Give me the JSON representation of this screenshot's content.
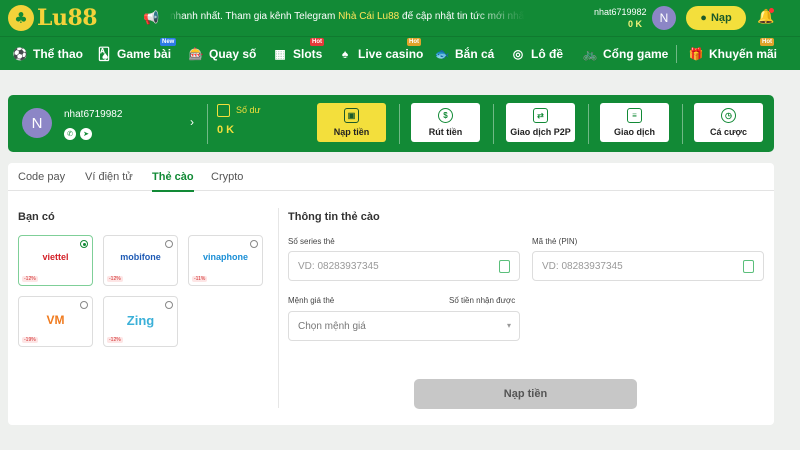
{
  "brand": {
    "logo_text": "Lu88",
    "logo_mark": "♣"
  },
  "topbar": {
    "announcement_pre": "nhanh nhất. Tham gia kênh Telegram ",
    "announcement_highlight": "Nhà Cái Lu88",
    "announcement_post": " để cập nhật tin tức mới nhất về mọi hoạt độ",
    "username": "nhat6719982",
    "balance": "0 K",
    "avatar_initial": "N",
    "deposit_label": "Nạp"
  },
  "nav": {
    "items": [
      {
        "label": "Thể thao",
        "icon": "soccer-icon"
      },
      {
        "label": "Game bài",
        "icon": "cards-icon",
        "tag": "New"
      },
      {
        "label": "Quay số",
        "icon": "lottery-icon"
      },
      {
        "label": "Slots",
        "icon": "slots-icon",
        "tag": "Hot"
      },
      {
        "label": "Live casino",
        "icon": "dealer-icon",
        "tag": "Hot"
      },
      {
        "label": "Bắn cá",
        "icon": "fish-icon"
      },
      {
        "label": "Lô đề",
        "icon": "balls-icon"
      },
      {
        "label": "Cổng game",
        "icon": "bicycle-icon"
      },
      {
        "label": "Khuyến mãi",
        "icon": "gift-icon",
        "tag": "Hot"
      }
    ]
  },
  "profile": {
    "avatar_initial": "N",
    "username": "nhat6719982",
    "balance_label": "Số dư",
    "balance_value": "0 K",
    "actions": [
      {
        "label": "Nạp tiền",
        "icon": "wallet-icon",
        "active": true
      },
      {
        "label": "Rút tiền",
        "icon": "withdraw-icon"
      },
      {
        "label": "Giao dịch P2P",
        "icon": "p2p-icon"
      },
      {
        "label": "Giao dịch",
        "icon": "transaction-icon"
      },
      {
        "label": "Cá cược",
        "icon": "clock-icon"
      }
    ]
  },
  "tabs": [
    {
      "label": "Code pay"
    },
    {
      "label": "Ví điện tử"
    },
    {
      "label": "Thẻ cào",
      "active": true
    },
    {
      "label": "Crypto"
    }
  ],
  "left_panel": {
    "title": "Bạn có",
    "providers": [
      {
        "name": "viettel",
        "discount": "-12%",
        "selected": true,
        "color": "#d31f26"
      },
      {
        "name": "mobifone",
        "discount": "-12%",
        "color": "#1f5bb5"
      },
      {
        "name": "vinaphone",
        "discount": "-11%",
        "color": "#1b8fd6"
      },
      {
        "name": "vietnamobile",
        "discount": "-19%",
        "color": "#f07b1f"
      },
      {
        "name": "Zing",
        "discount": "-12%",
        "color": "#3bb0d8"
      }
    ]
  },
  "right_panel": {
    "title": "Thông tin thẻ cào",
    "serial_label": "Số series thẻ",
    "serial_placeholder": "VD: 08283937345",
    "pin_label": "Mã thẻ (PIN)",
    "pin_placeholder": "VD: 08283937345",
    "denomination_label": "Mệnh giá thẻ",
    "receive_label": "Số tiền nhận được",
    "denomination_placeholder": "Chọn mệnh giá",
    "submit_label": "Nạp tiền"
  },
  "colors": {
    "primary_green": "#128a36",
    "accent_yellow": "#f3df3c",
    "avatar": "#8c86c6"
  }
}
